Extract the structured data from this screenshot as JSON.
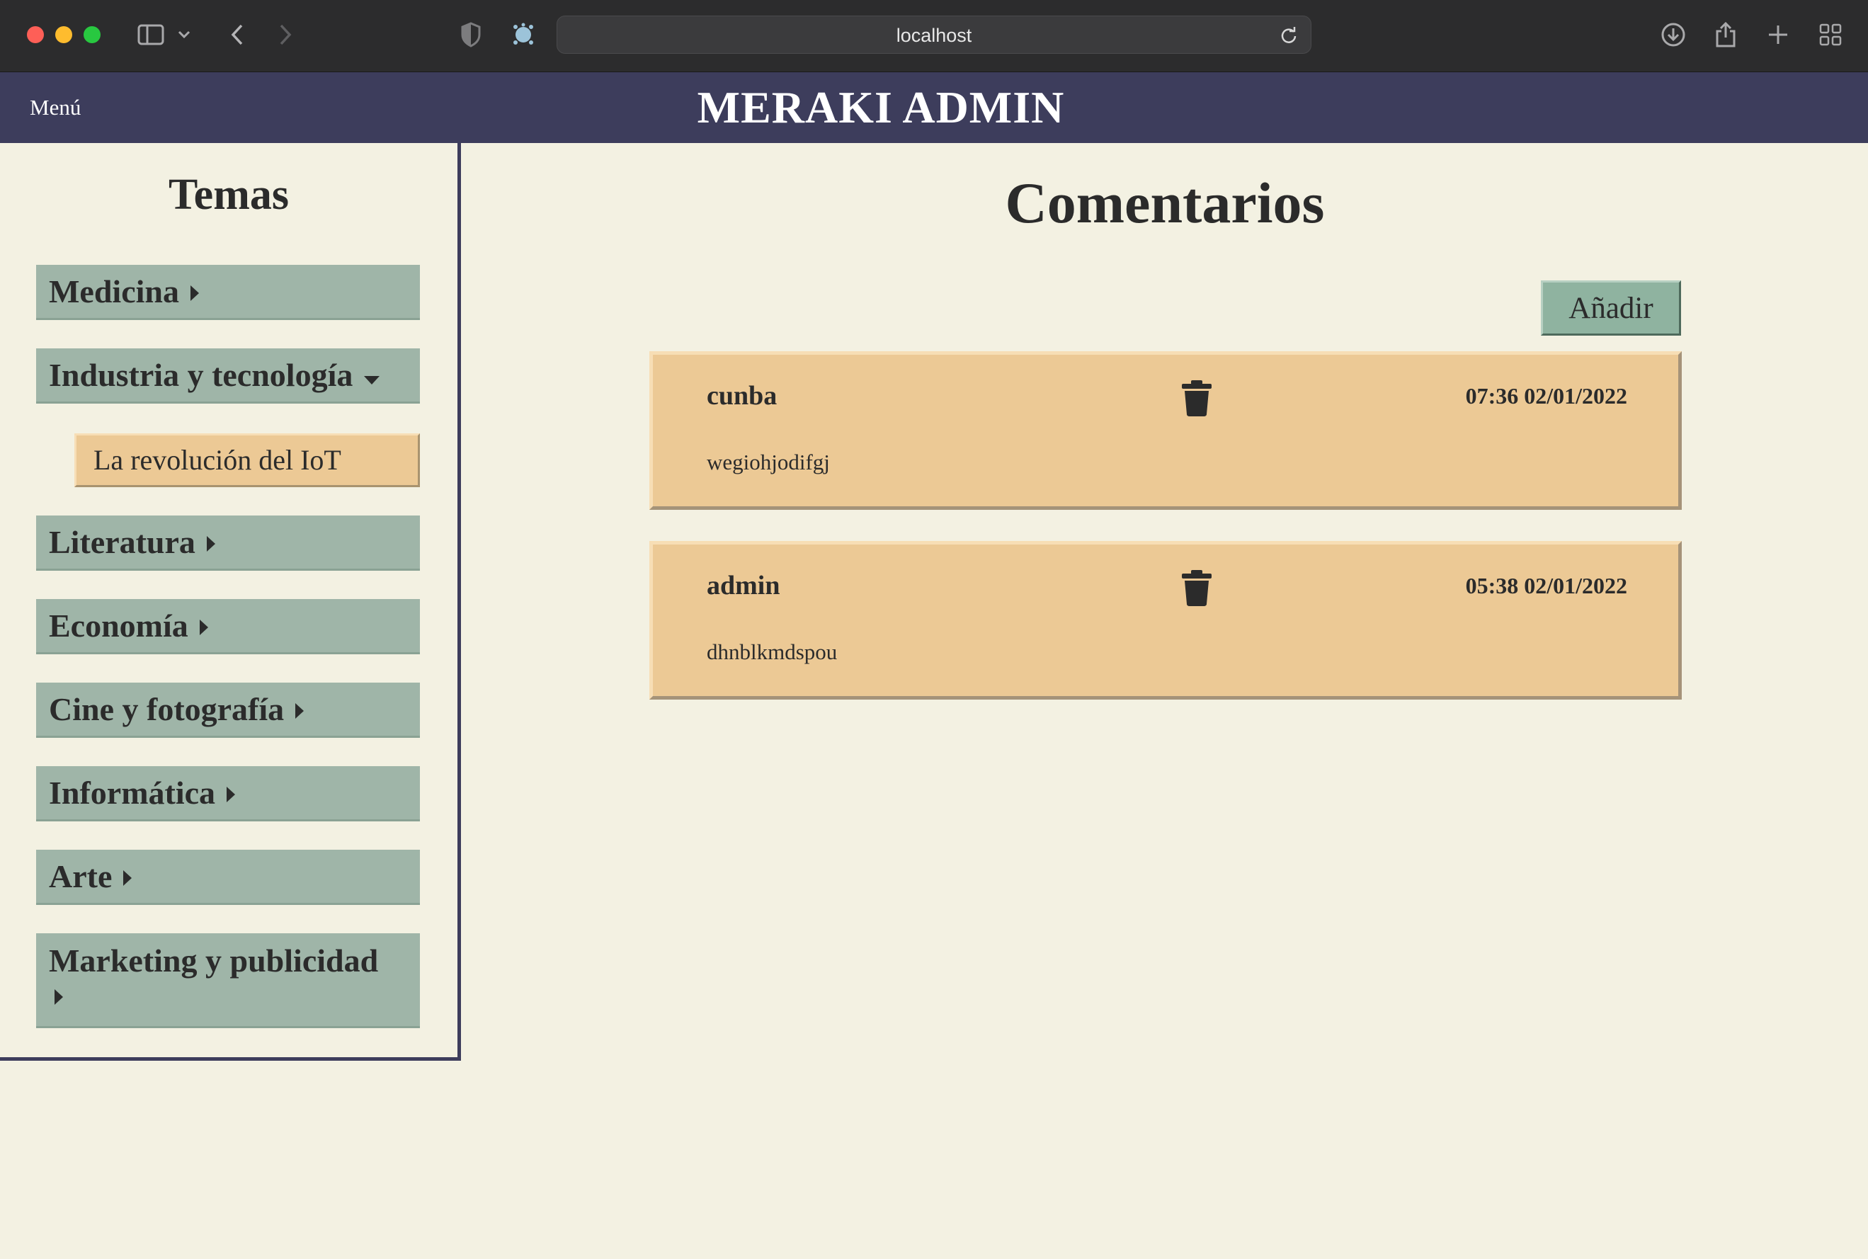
{
  "browser": {
    "url": "localhost",
    "icons": [
      "sidebar-icon",
      "chevron-down-icon",
      "back-icon",
      "forward-icon",
      "shield-icon",
      "extension-icon",
      "reload-icon",
      "download-icon",
      "share-icon",
      "new-tab-icon",
      "tab-overview-icon"
    ]
  },
  "header": {
    "menu_label": "Menú",
    "title": "MERAKI ADMIN",
    "background": "#3d3d5c"
  },
  "sidebar": {
    "title": "Temas",
    "topics": [
      {
        "label": "Medicina",
        "expanded": false
      },
      {
        "label": "Industria y tecnología",
        "expanded": true,
        "subtopics": [
          {
            "label": "La revolución del IoT",
            "selected": true
          }
        ]
      },
      {
        "label": "Literatura",
        "expanded": false
      },
      {
        "label": "Economía",
        "expanded": false
      },
      {
        "label": "Cine y fotografía",
        "expanded": false
      },
      {
        "label": "Informática",
        "expanded": false
      },
      {
        "label": "Arte",
        "expanded": false
      },
      {
        "label": "Marketing y publicidad",
        "expanded": false
      }
    ]
  },
  "main": {
    "title": "Comentarios",
    "add_label": "Añadir",
    "comments": [
      {
        "author": "cunba",
        "timestamp": "07:36 02/01/2022",
        "text": "wegiohjodifgj"
      },
      {
        "author": "admin",
        "timestamp": "05:38 02/01/2022",
        "text": "dhnblkmdspou"
      }
    ]
  },
  "colors": {
    "page_bg": "#f3f1e2",
    "topic_bg": "#9fb5a8",
    "card_bg": "#ecc995",
    "button_bg": "#8fb3a0"
  }
}
